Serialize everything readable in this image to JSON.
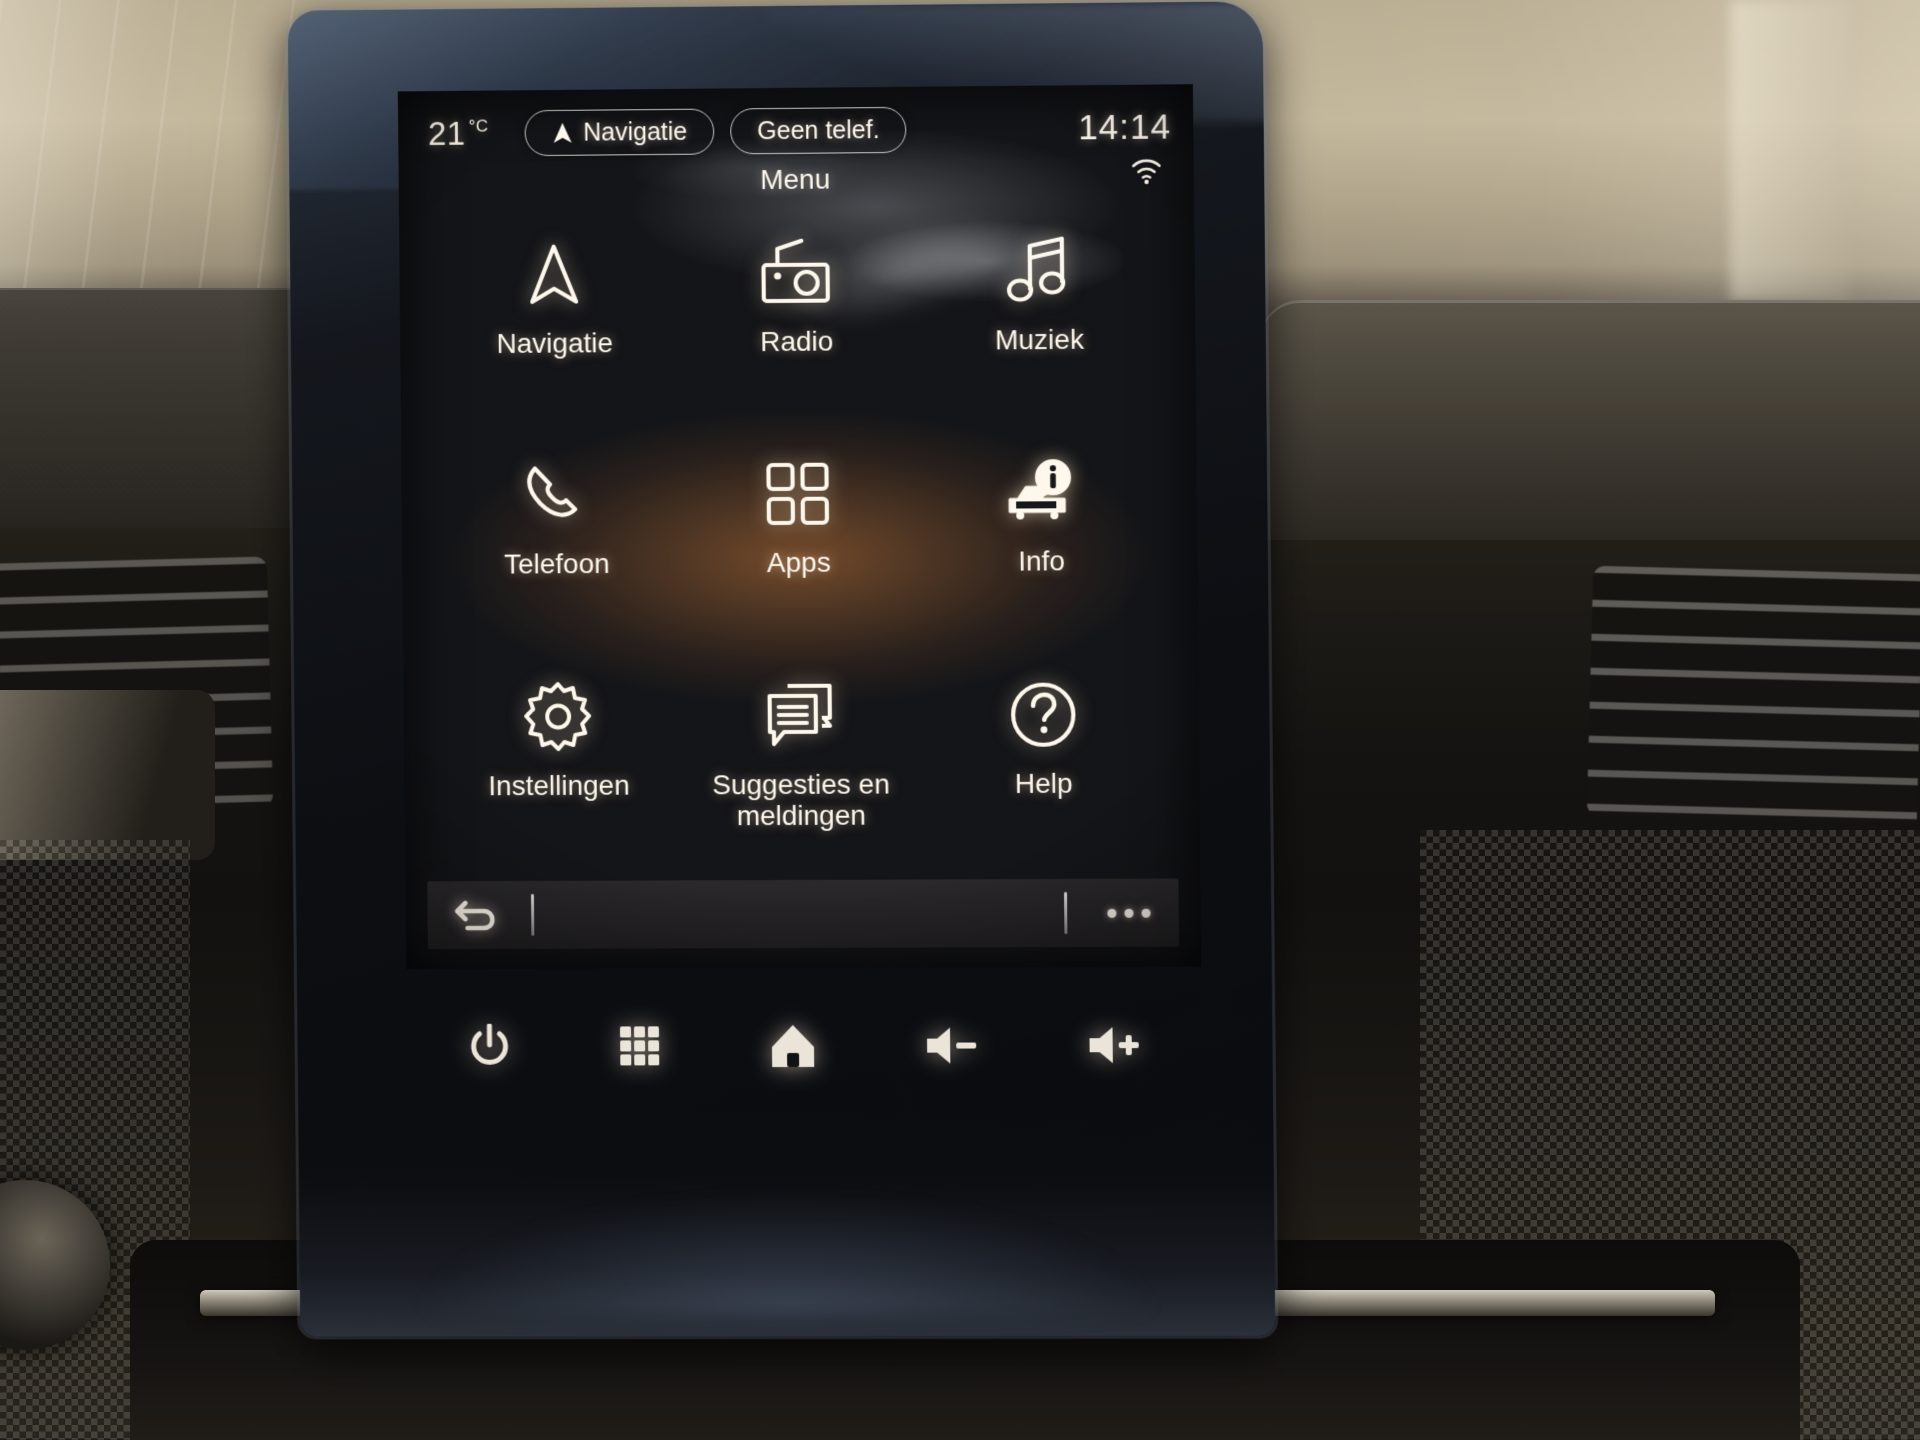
{
  "statusbar": {
    "temperature": "21",
    "temperature_unit": "°C",
    "nav_pill_label": "Navigatie",
    "phone_pill_label": "Geen telef.",
    "clock": "14:14",
    "wifi_icon": "wifi-icon"
  },
  "screen": {
    "title": "Menu"
  },
  "menu": {
    "tiles": [
      {
        "id": "navigatie",
        "label": "Navigatie",
        "icon": "navigation-arrow-icon"
      },
      {
        "id": "radio",
        "label": "Radio",
        "icon": "radio-icon"
      },
      {
        "id": "muziek",
        "label": "Muziek",
        "icon": "music-note-icon"
      },
      {
        "id": "telefoon",
        "label": "Telefoon",
        "icon": "phone-handset-icon"
      },
      {
        "id": "apps",
        "label": "Apps",
        "icon": "grid-four-squares-icon"
      },
      {
        "id": "info",
        "label": "Info",
        "icon": "car-info-bubble-icon"
      },
      {
        "id": "instellingen",
        "label": "Instellingen",
        "icon": "gear-icon"
      },
      {
        "id": "suggesties",
        "label": "Suggesties en meldingen",
        "icon": "speech-bubbles-icon"
      },
      {
        "id": "help",
        "label": "Help",
        "icon": "question-mark-circle-icon"
      }
    ]
  },
  "context_bar": {
    "back_icon": "back-arrow-icon",
    "more_icon": "more-dots-icon"
  },
  "hardware_keys": [
    {
      "id": "power",
      "icon": "power-icon"
    },
    {
      "id": "apps-grid",
      "icon": "grid-nine-squares-icon"
    },
    {
      "id": "home",
      "icon": "home-icon"
    },
    {
      "id": "volume-down",
      "icon": "volume-minus-icon"
    },
    {
      "id": "volume-up",
      "icon": "volume-plus-icon"
    }
  ],
  "colors": {
    "screen_bg": "#141518",
    "text": "#fdf7ec",
    "glow_warm": "#c67028"
  }
}
